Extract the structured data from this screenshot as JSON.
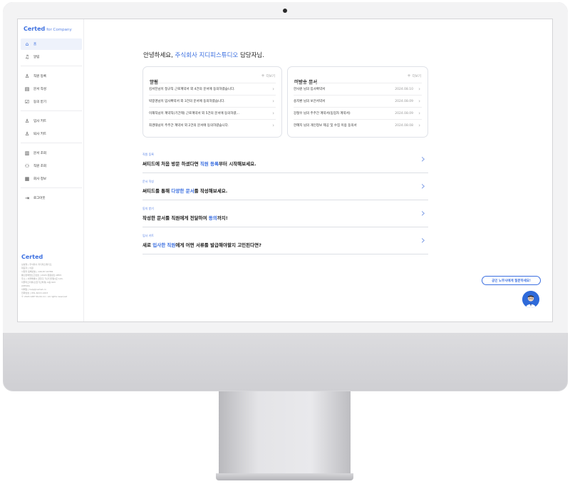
{
  "sidebar": {
    "brand": "Certed",
    "brand_sub": "for Company",
    "items": [
      {
        "label": "홈",
        "icon": "home-icon",
        "active": true
      },
      {
        "label": "알림",
        "icon": "bell-icon"
      },
      {
        "label": "직원 등록",
        "icon": "person-icon"
      },
      {
        "label": "문서 작성",
        "icon": "document-icon"
      },
      {
        "label": "동의 받기",
        "icon": "checkbox-icon"
      },
      {
        "label": "입사 키트",
        "icon": "person-add-icon"
      },
      {
        "label": "퇴사 키트",
        "icon": "person-remove-icon"
      },
      {
        "label": "문서 조회",
        "icon": "document-search-icon"
      },
      {
        "label": "직원 조회",
        "icon": "people-icon"
      },
      {
        "label": "회사 정보",
        "icon": "building-icon"
      },
      {
        "label": "로그아웃",
        "icon": "logout-icon"
      }
    ],
    "footer_brand": "Certed",
    "footer_lines": [
      "상호명 | 주식회사 지디피스튜디오",
      "대표자 | 이원",
      "사업자 등록번호 | 149-87-02384",
      "통신판매업신고번호 | 2023-창원성산-0855",
      "주소 | 서울특별시 금천구 가산디지털1로 120,",
      "지플러스타워(신한가산타워) 9층 903",
      "(08590)",
      "이메일 | help@certed.co",
      "전화번호 | 051-6213-1203",
      "© 2024 GDP Studio Inc. All rights reserved"
    ]
  },
  "greeting": {
    "prefix": "안녕하세요, ",
    "company": "주식회사 지디피스튜디오",
    "suffix": " 담당자님."
  },
  "notifications": {
    "title": "알림",
    "more": "더보기",
    "items": [
      "김서진님이 정규직 근로계약서 외 4건의 문서에 동의하였습니다.",
      "박중명님이 입사확약서 외 3건의 문서에 동의하였습니다.",
      "이재직님이 계약직(기간제) 근로계약서 외 5건의 문서에 동의하였...",
      "최경태님이 주주간 계약서 외 2건의 문서에 동의하였습니다."
    ]
  },
  "unsent": {
    "title": "미발송 문서",
    "more": "더보기",
    "items": [
      {
        "text": "한사원 님의 입사확약서",
        "date": "2024.08.10"
      },
      {
        "text": "송지환 님의 보안서약서",
        "date": "2024.08.09"
      },
      {
        "text": "강철우 님의 주주간 계약서(동업자 계약서)",
        "date": "2024.08.09"
      },
      {
        "text": "한혜지 님의 개인정보 제공 및 수집 이용 동의서",
        "date": "2024.08.08"
      }
    ]
  },
  "guides": [
    {
      "category": "직원 등록",
      "pre": "써티드에 처음 방문 하셨다면 ",
      "hl": "직원 등록",
      "post": "부터 시작해보세요."
    },
    {
      "category": "문서 작성",
      "pre": "써티드를 통해 ",
      "hl": "다양한 문서",
      "post": "를 작성해보세요."
    },
    {
      "category": "동의 받기",
      "pre": "작성한 문서를 직원에게 전달하여 ",
      "hl": "동의",
      "post": "까지!"
    },
    {
      "category": "입사 키트",
      "pre": "새로 ",
      "hl": "입사한 직원",
      "post": "에게 어떤 서류를 발급해야할지 고민된다면?"
    }
  ],
  "ask_button": "공인 노무사에게 질문하세요!",
  "colors": {
    "accent": "#3b6fe0"
  }
}
